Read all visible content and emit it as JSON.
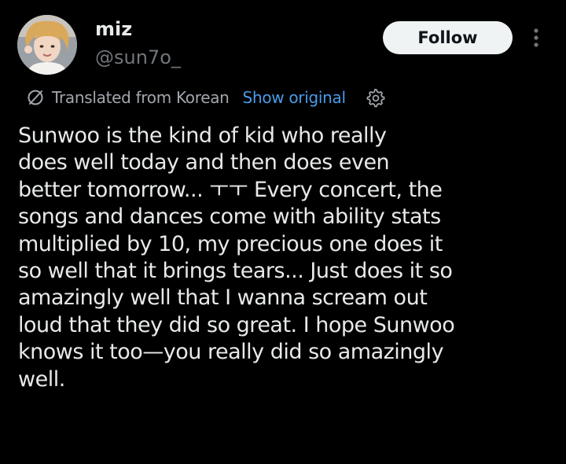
{
  "author": {
    "display_name": "miz",
    "handle": "@sun7o_",
    "avatar_icon": "user-avatar-photo"
  },
  "follow_button": {
    "label": "Follow"
  },
  "more_menu": {
    "icon": "more-vertical-icon"
  },
  "translation": {
    "icon": "translate-icon",
    "label": "Translated from Korean",
    "show_original_label": "Show original",
    "settings_icon": "gear-icon"
  },
  "tweet": {
    "lines": [
      "Sunwoo is the kind of kid who really",
      "does well today and then does even",
      "better tomorrow... ㅜㅜ Every concert, the",
      "songs and dances come with ability stats",
      "multiplied by 10, my precious one does it",
      "so well that it brings tears... Just does it so",
      "amazingly well that I wanna scream out",
      "loud that they did so great. I hope Sunwoo",
      "knows it too—you really did so amazingly",
      "well."
    ]
  },
  "colors": {
    "background": "#000000",
    "primary_text": "#e7e9ea",
    "secondary_text": "#71767b",
    "link": "#4a9be9",
    "follow_bg": "#eff3f4"
  }
}
